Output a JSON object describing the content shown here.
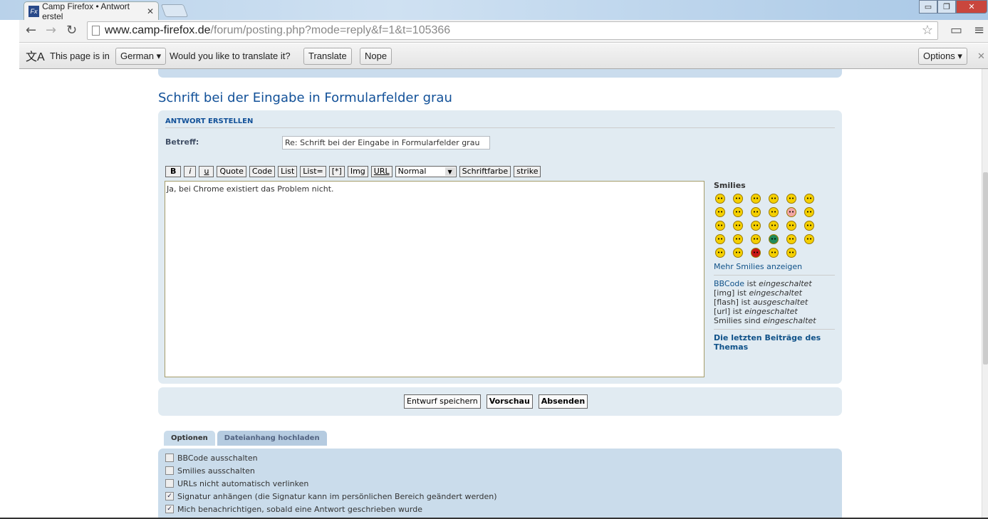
{
  "browser": {
    "tab_title": "Camp Firefox • Antwort erstel",
    "url_host": "www.camp-firefox.de",
    "url_path": "/forum/posting.php?mode=reply&f=1&t=105366"
  },
  "translate_bar": {
    "prefix": "This page is in",
    "language": "German",
    "question": "Would you like to translate it?",
    "translate": "Translate",
    "nope": "Nope",
    "options": "Options"
  },
  "page": {
    "title": "Schrift bei der Eingabe in Formularfelder grau",
    "section": "ANTWORT ERSTELLEN",
    "subject_label": "Betreff:",
    "subject_value": "Re: Schrift bei der Eingabe in Formularfelder grau",
    "bbcode": [
      "B",
      "i",
      "u",
      "Quote",
      "Code",
      "List",
      "List=",
      "[*]",
      "Img",
      "URL"
    ],
    "font_size": "Normal",
    "color_btn": "Schriftfarbe",
    "strike_btn": "strike",
    "message": "Ja, bei Chrome existiert das Problem nicht."
  },
  "sidebar": {
    "smilies_title": "Smilies",
    "more": "Mehr Smilies anzeigen",
    "status": [
      {
        "a": "BBCode",
        "b": " ist ",
        "c": "eingeschaltet"
      },
      {
        "a": "[img]",
        "b": " ist ",
        "c": "eingeschaltet"
      },
      {
        "a": "[flash]",
        "b": " ist ",
        "c": "ausgeschaltet"
      },
      {
        "a": "[url]",
        "b": " ist ",
        "c": "eingeschaltet"
      },
      {
        "a": "Smilies",
        "b": " sind ",
        "c": "eingeschaltet"
      }
    ],
    "last_posts": "Die letzten Beiträge des Themas"
  },
  "buttons": {
    "draft": "Entwurf speichern",
    "preview": "Vorschau",
    "submit": "Absenden"
  },
  "tabs": {
    "options": "Optionen",
    "attach": "Dateianhang hochladen"
  },
  "options": [
    {
      "label": "BBCode ausschalten",
      "checked": false
    },
    {
      "label": "Smilies ausschalten",
      "checked": false
    },
    {
      "label": "URLs nicht automatisch verlinken",
      "checked": false
    },
    {
      "label": "Signatur anhängen (die Signatur kann im persönlichen Bereich geändert werden)",
      "checked": true
    },
    {
      "label": "Mich benachrichtigen, sobald eine Antwort geschrieben wurde",
      "checked": true
    }
  ]
}
